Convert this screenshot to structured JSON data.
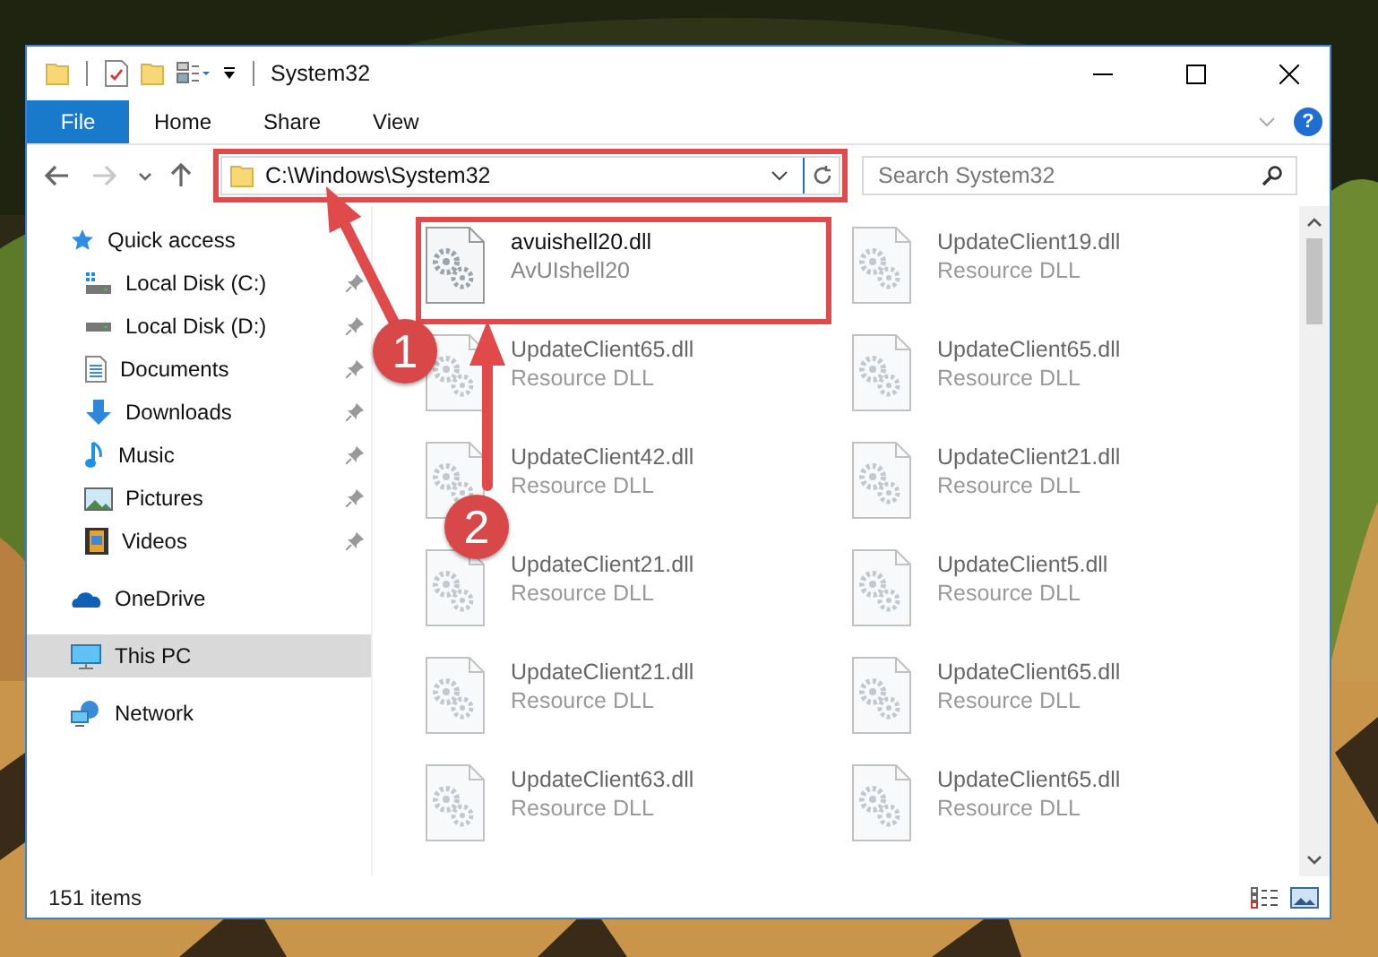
{
  "window": {
    "title": "System32"
  },
  "ribbon": {
    "tabs": [
      {
        "label": "File",
        "kind": "file"
      },
      {
        "label": "Home",
        "kind": "tab"
      },
      {
        "label": "Share",
        "kind": "tab"
      },
      {
        "label": "View",
        "kind": "tab"
      }
    ],
    "help": "?"
  },
  "navigation": [
    {
      "kind": "back",
      "disabled": false
    },
    {
      "kind": "forward",
      "disabled": true
    },
    {
      "kind": "recent",
      "disabled": false
    },
    {
      "kind": "up",
      "disabled": false
    }
  ],
  "address": {
    "path": "C:\\Windows\\System32",
    "highlighted": true
  },
  "search": {
    "placeholder": "Search System32"
  },
  "sidebar": {
    "items": [
      {
        "label": "Quick access",
        "kind": "star",
        "selected": false,
        "children": [
          {
            "label": "Local Disk (C:)",
            "kind": "disk-c",
            "selected": false,
            "pinned": true
          },
          {
            "label": "Local Disk (D:)",
            "kind": "disk",
            "selected": false,
            "pinned": true
          },
          {
            "label": "Documents",
            "kind": "documents",
            "selected": false,
            "pinned": true
          },
          {
            "label": "Downloads",
            "kind": "downloads",
            "selected": false,
            "pinned": true
          },
          {
            "label": "Music",
            "kind": "music",
            "selected": false,
            "pinned": true
          },
          {
            "label": "Pictures",
            "kind": "pictures",
            "selected": false,
            "pinned": true
          },
          {
            "label": "Videos",
            "kind": "videos",
            "selected": false,
            "pinned": true
          }
        ]
      },
      {
        "label": "OneDrive",
        "kind": "cloud",
        "selected": false
      },
      {
        "label": "This PC",
        "kind": "pc",
        "selected": true
      },
      {
        "label": "Network",
        "kind": "network",
        "selected": false
      }
    ]
  },
  "files": [
    {
      "name": "avuishell20.dll",
      "description": "AvUIshell20",
      "blurred": false,
      "highlighted": true
    },
    {
      "name": "UpdateClient19.dll",
      "description": "Resource DLL",
      "blurred": true,
      "highlighted": false
    },
    {
      "name": "UpdateClient65.dll",
      "description": "Resource DLL",
      "blurred": true,
      "highlighted": false
    },
    {
      "name": "UpdateClient65.dll",
      "description": "Resource DLL",
      "blurred": true,
      "highlighted": false
    },
    {
      "name": "UpdateClient42.dll",
      "description": "Resource DLL",
      "blurred": true,
      "highlighted": false
    },
    {
      "name": "UpdateClient21.dll",
      "description": "Resource DLL",
      "blurred": true,
      "highlighted": false
    },
    {
      "name": "UpdateClient21.dll",
      "description": "Resource DLL",
      "blurred": true,
      "highlighted": false
    },
    {
      "name": "UpdateClient5.dll",
      "description": "Resource DLL",
      "blurred": true,
      "highlighted": false
    },
    {
      "name": "UpdateClient21.dll",
      "description": "Resource DLL",
      "blurred": true,
      "highlighted": false
    },
    {
      "name": "UpdateClient65.dll",
      "description": "Resource DLL",
      "blurred": true,
      "highlighted": false
    },
    {
      "name": "UpdateClient63.dll",
      "description": "Resource DLL",
      "blurred": true,
      "highlighted": false
    },
    {
      "name": "UpdateClient65.dll",
      "description": "Resource DLL",
      "blurred": true,
      "highlighted": false
    }
  ],
  "status_bar": {
    "item_count": "151 items"
  },
  "annotations": [
    {
      "label": "1"
    },
    {
      "label": "2"
    }
  ]
}
